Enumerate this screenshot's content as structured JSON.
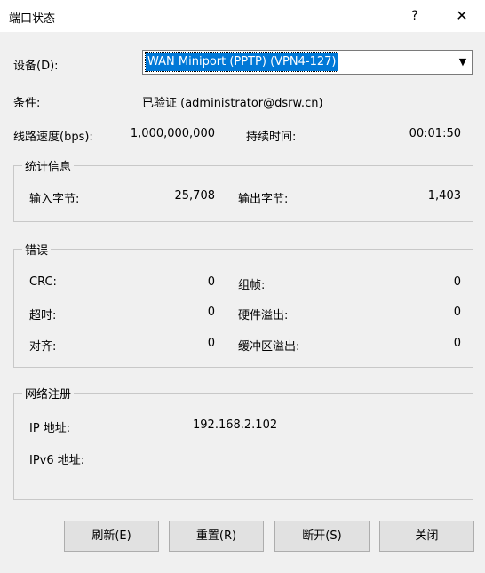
{
  "window": {
    "title": "端口状态",
    "help_label": "?",
    "close_label": "✕"
  },
  "device": {
    "label": "设备(D):",
    "selected": "WAN Miniport (PPTP) (VPN4-127)",
    "arrow": "▼"
  },
  "condition": {
    "label": "条件:",
    "value": "已验证 (administrator@dsrw.cn)"
  },
  "line_speed": {
    "label": "线路速度(bps):",
    "value": "1,000,000,000"
  },
  "duration": {
    "label": "持续时间:",
    "value": "00:01:50"
  },
  "stats": {
    "title": "统计信息",
    "bytes_in_label": "输入字节:",
    "bytes_in_value": "25,708",
    "bytes_out_label": "输出字节:",
    "bytes_out_value": "1,403"
  },
  "errors": {
    "title": "错误",
    "crc_label": "CRC:",
    "crc_value": "0",
    "framing_label": "组帧:",
    "framing_value": "0",
    "timeout_label": "超时:",
    "timeout_value": "0",
    "hw_overrun_label": "硬件溢出:",
    "hw_overrun_value": "0",
    "alignment_label": "对齐:",
    "alignment_value": "0",
    "buffer_overrun_label": "缓冲区溢出:",
    "buffer_overrun_value": "0"
  },
  "network": {
    "title": "网络注册",
    "ip_label": "IP 地址:",
    "ip_value": "192.168.2.102",
    "ipv6_label": "IPv6 地址:"
  },
  "buttons": {
    "refresh": "刷新(E)",
    "reset": "重置(R)",
    "disconnect": "断开(S)",
    "close": "关闭"
  }
}
